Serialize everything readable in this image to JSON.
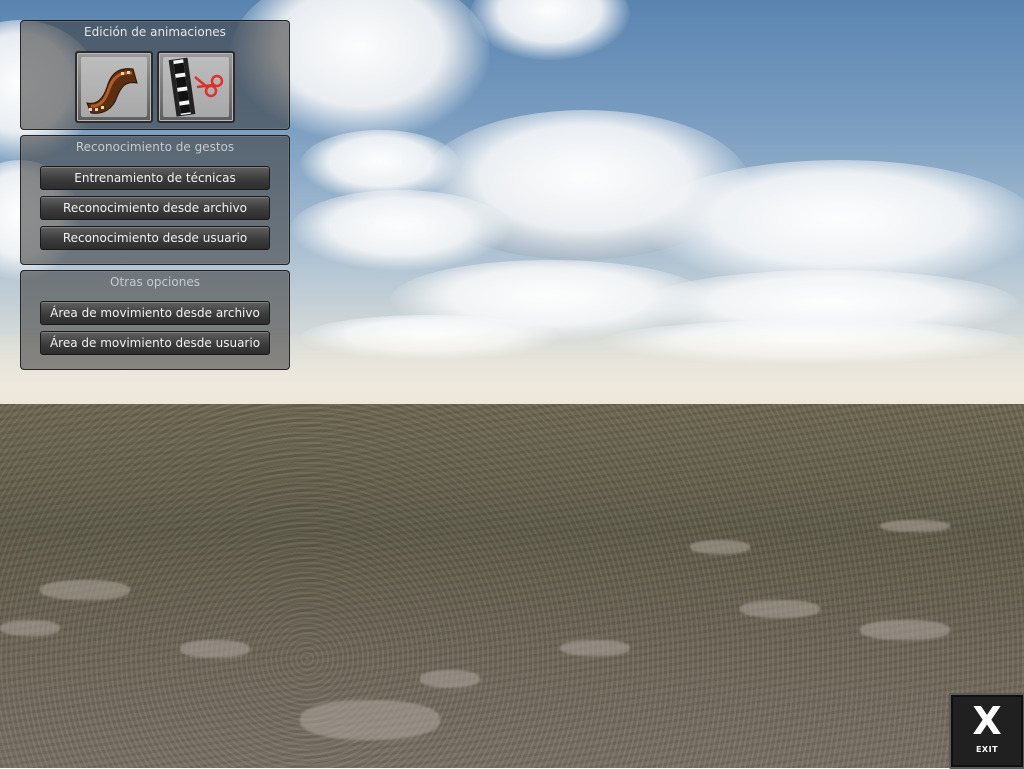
{
  "panels": {
    "animation_editing": {
      "title": "Edición de animaciones",
      "buttons": [
        {
          "icon": "film-strip-icon"
        },
        {
          "icon": "film-cut-scissors-icon"
        }
      ]
    },
    "gesture_recognition": {
      "title": "Reconocimiento de gestos",
      "buttons": [
        {
          "label": "Entrenamiento de técnicas"
        },
        {
          "label": "Reconocimiento desde archivo"
        },
        {
          "label": "Reconocimiento desde usuario"
        }
      ]
    },
    "other_options": {
      "title": "Otras opciones",
      "buttons": [
        {
          "label": "Área de movimiento desde archivo"
        },
        {
          "label": "Área de movimiento desde usuario"
        }
      ]
    }
  },
  "exit_button": {
    "glyph": "X",
    "label": "EXIT"
  },
  "colors": {
    "panel_bg": "#3c3c3c",
    "button_text": "#f2f2f2",
    "scissors": "#e0302a"
  }
}
